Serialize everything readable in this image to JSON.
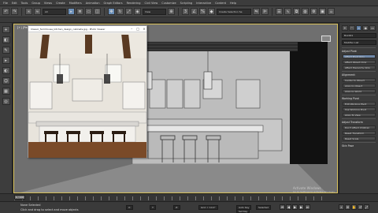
{
  "menu": [
    "File",
    "Edit",
    "Tools",
    "Group",
    "Views",
    "Create",
    "Modifiers",
    "Animation",
    "Graph Editors",
    "Rendering",
    "Civil View",
    "Customize",
    "Scripting",
    "Interactive",
    "Content",
    "Help"
  ],
  "toolbar": {
    "selection_filter": "All",
    "viewport_combo": "View",
    "named_sets": "Create Selection Se"
  },
  "viewport": {
    "label": "[+] [Perspective] [Standard] [Wireframe]"
  },
  "reference_window": {
    "title": "Classic_farmhouse_kitchen_design_cabinets.jpg - Photo Viewer",
    "controls": [
      "–",
      "□",
      "×"
    ]
  },
  "command_panel": {
    "tabs": [
      "+",
      "◠",
      "≡",
      "◉",
      "▭",
      "🔧"
    ],
    "object_name": "Box001",
    "modifier_list": "Modifier List",
    "rollouts": [
      {
        "title": "Adjust Pivot",
        "items": [
          "Affect Pivot Only",
          "Affect Object Only",
          "Affect Hierarchy Only"
        ]
      },
      {
        "title": "Alignment:",
        "items": [
          "Center to Object",
          "Align to Object",
          "Align to World"
        ]
      },
      {
        "title": "Working Pivot",
        "items": [
          "Edit Working Pivot",
          "Use Working Pivot",
          "Align To View"
        ]
      },
      {
        "title": "Adjust Transform",
        "items": [
          "Don't Affect Children",
          "Reset Transform",
          "Reset Scale"
        ]
      },
      {
        "title": "Skin Pose",
        "items": []
      }
    ]
  },
  "timeline": {
    "frame": "0 / 100"
  },
  "status": {
    "selection": "None Selected",
    "hint": "Click and drag to select and move objects",
    "coords": [
      "X:",
      "Y:",
      "Z:"
    ],
    "grid": "Grid = 10.0\"",
    "auto_key": "Auto Key",
    "set_key": "Set Key",
    "selected": "Selected"
  },
  "watermark": {
    "line1": "Activate Windows",
    "line2": "Go to Settings to activate Windows."
  },
  "colors": {
    "viewport_bg": "#6f6f6f",
    "active_border": "#d9c15a",
    "ui_dark": "#3b3b3b",
    "highlight": "#6f88a8"
  }
}
